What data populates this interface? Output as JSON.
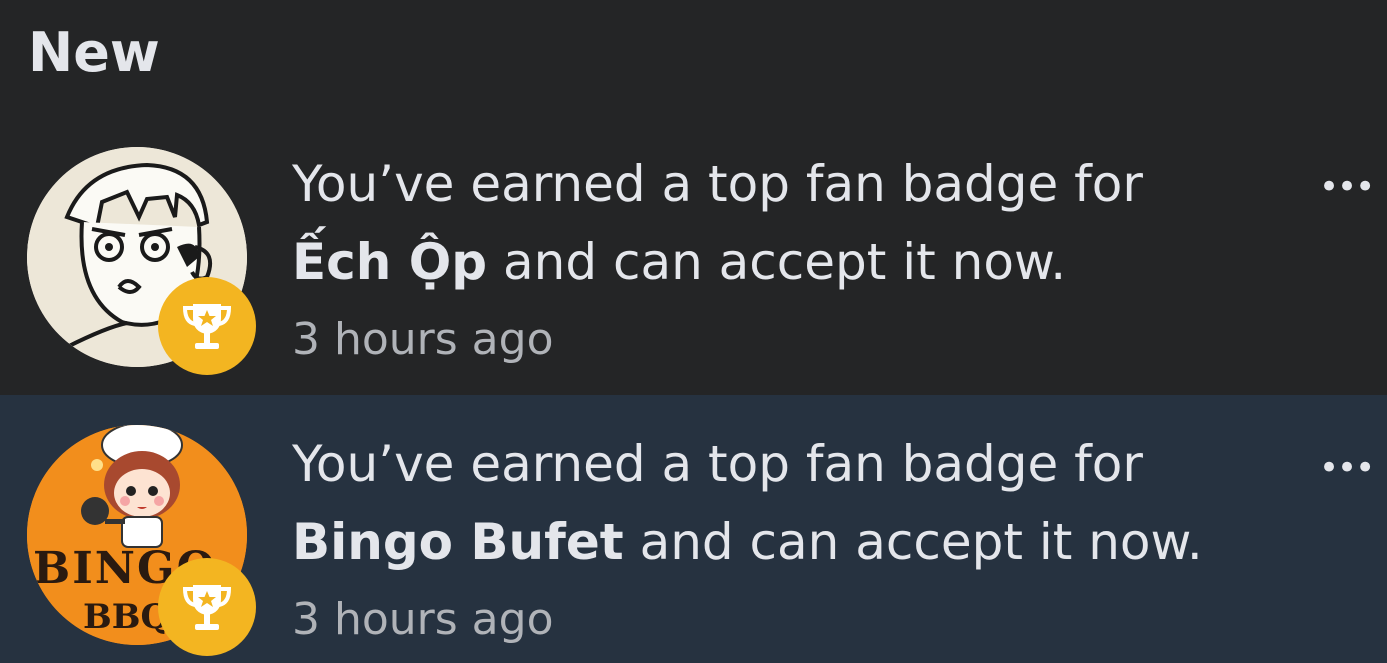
{
  "section": {
    "title": "New"
  },
  "notifications": [
    {
      "prefix": "You’ve earned a top fan badge for",
      "name": "Ếch Ộp",
      "suffix": " and can accept it now.",
      "time": "3 hours ago",
      "more_label": "•••",
      "avatar_icon": "sketch-boy-avatar",
      "badge_icon": "trophy-icon"
    },
    {
      "prefix": "You’ve earned a top fan badge for",
      "name": "Bingo Bufet",
      "suffix": " and can accept it now.",
      "time": "3 hours ago",
      "more_label": "•••",
      "avatar_icon": "chef-girl-avatar",
      "badge_icon": "trophy-icon",
      "avatar_text_1": "BINGO",
      "avatar_text_2": "BBQ"
    }
  ],
  "colors": {
    "background": "#242526",
    "highlight_row": "#263240",
    "badge": "#f3b521",
    "text": "#e4e6eb",
    "secondary_text": "#b0b3b8"
  }
}
